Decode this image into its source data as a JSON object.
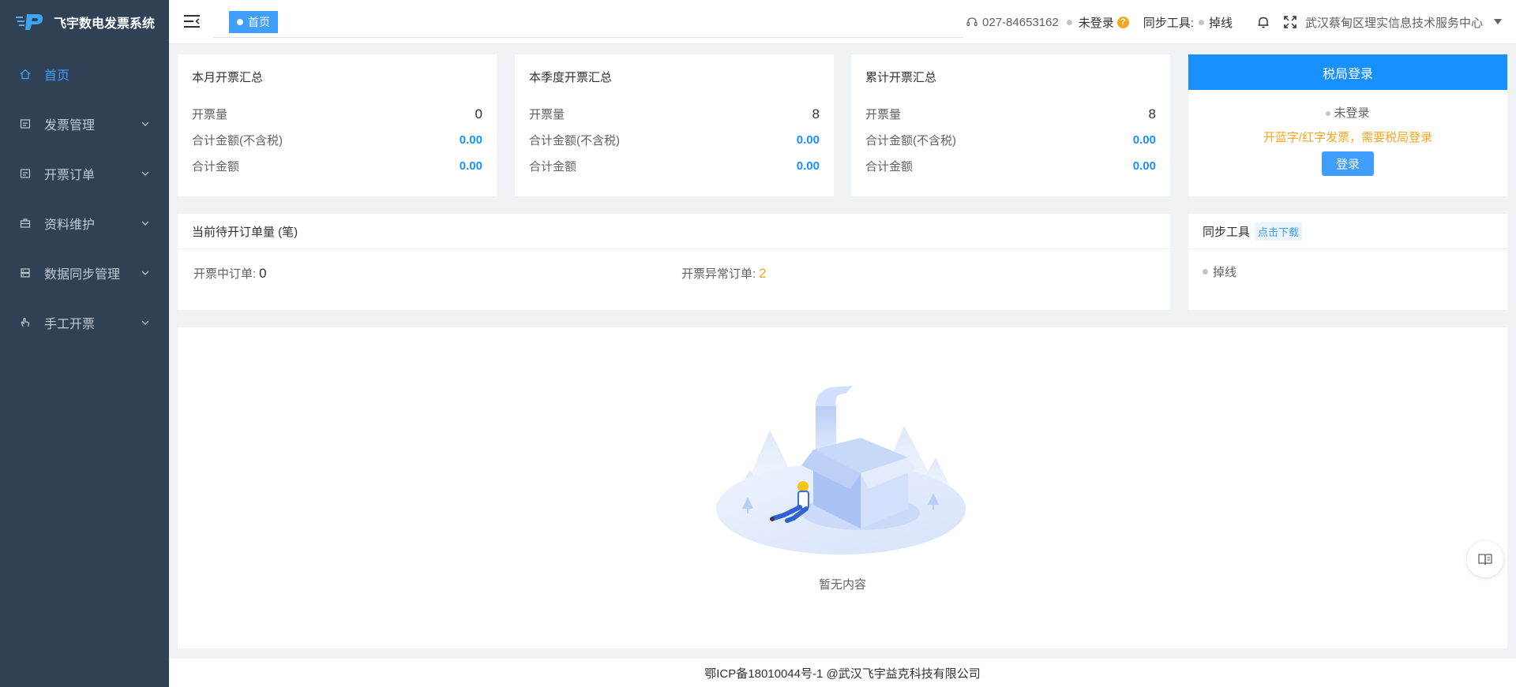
{
  "app": {
    "title": "飞宇数电发票系统"
  },
  "sidebar": {
    "items": [
      {
        "label": "首页",
        "icon": "home-icon",
        "active": true
      },
      {
        "label": "发票管理",
        "icon": "invoice-icon"
      },
      {
        "label": "开票订单",
        "icon": "order-icon"
      },
      {
        "label": "资料维护",
        "icon": "briefcase-icon"
      },
      {
        "label": "数据同步管理",
        "icon": "database-icon"
      },
      {
        "label": "手工开票",
        "icon": "hand-icon"
      }
    ]
  },
  "header": {
    "tag": "首页",
    "phone": "027-84653162",
    "login_status": "未登录",
    "help_mark": "?",
    "sync_label": "同步工具:",
    "sync_status": "掉线",
    "org_name": "武汉蔡甸区理实信息技术服务中心"
  },
  "summaries": [
    {
      "title": "本月开票汇总",
      "count_label": "开票量",
      "count": "0",
      "amount_ex_tax_label": "合计金额(不含税)",
      "amount_ex_tax": "0.00",
      "amount_label": "合计金额",
      "amount": "0.00"
    },
    {
      "title": "本季度开票汇总",
      "count_label": "开票量",
      "count": "8",
      "amount_ex_tax_label": "合计金额(不含税)",
      "amount_ex_tax": "0.00",
      "amount_label": "合计金额",
      "amount": "0.00"
    },
    {
      "title": "累计开票汇总",
      "count_label": "开票量",
      "count": "8",
      "amount_ex_tax_label": "合计金额(不含税)",
      "amount_ex_tax": "0.00",
      "amount_label": "合计金额",
      "amount": "0.00"
    }
  ],
  "tax_login": {
    "title": "税局登录",
    "status": "未登录",
    "warning": "开蓝字/红字发票，需要税局登录",
    "button": "登录"
  },
  "orders": {
    "title": "当前待开订单量 (笔)",
    "in_progress_label": "开票中订单:",
    "in_progress": "0",
    "error_label": "开票异常订单:",
    "error": "2"
  },
  "sync_tool": {
    "title": "同步工具",
    "download": "点击下载",
    "status": "掉线"
  },
  "empty": {
    "text": "暂无内容"
  },
  "footer": {
    "text": "鄂ICP备18010044号-1 @武汉飞宇益克科技有限公司"
  },
  "colors": {
    "sidebar_bg": "#304156",
    "primary": "#1890ff",
    "warning": "#f5a623"
  }
}
